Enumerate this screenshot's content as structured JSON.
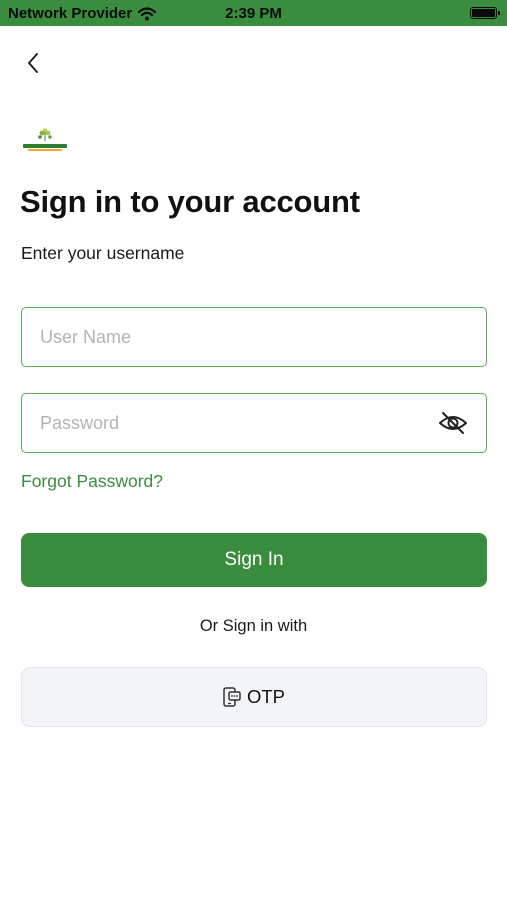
{
  "status_bar": {
    "carrier": "Network Provider",
    "time": "2:39 PM"
  },
  "header": {
    "back_icon": "chevron-left-icon"
  },
  "logo": {
    "icon": "brand-logo"
  },
  "login": {
    "title": "Sign in to your account",
    "subtitle": "Enter your username",
    "username_placeholder": "User Name",
    "username_value": "",
    "password_placeholder": "Password",
    "password_value": "",
    "password_toggle_icon": "eye-off-icon",
    "forgot_password": "Forgot Password?",
    "sign_in_label": "Sign In",
    "alt_label": "Or Sign in with",
    "otp_label": "OTP",
    "otp_icon": "phone-otp-icon"
  },
  "colors": {
    "brand_green": "#3a8d3f",
    "field_border": "#5aa85e",
    "otp_background": "#f2f4f7"
  }
}
